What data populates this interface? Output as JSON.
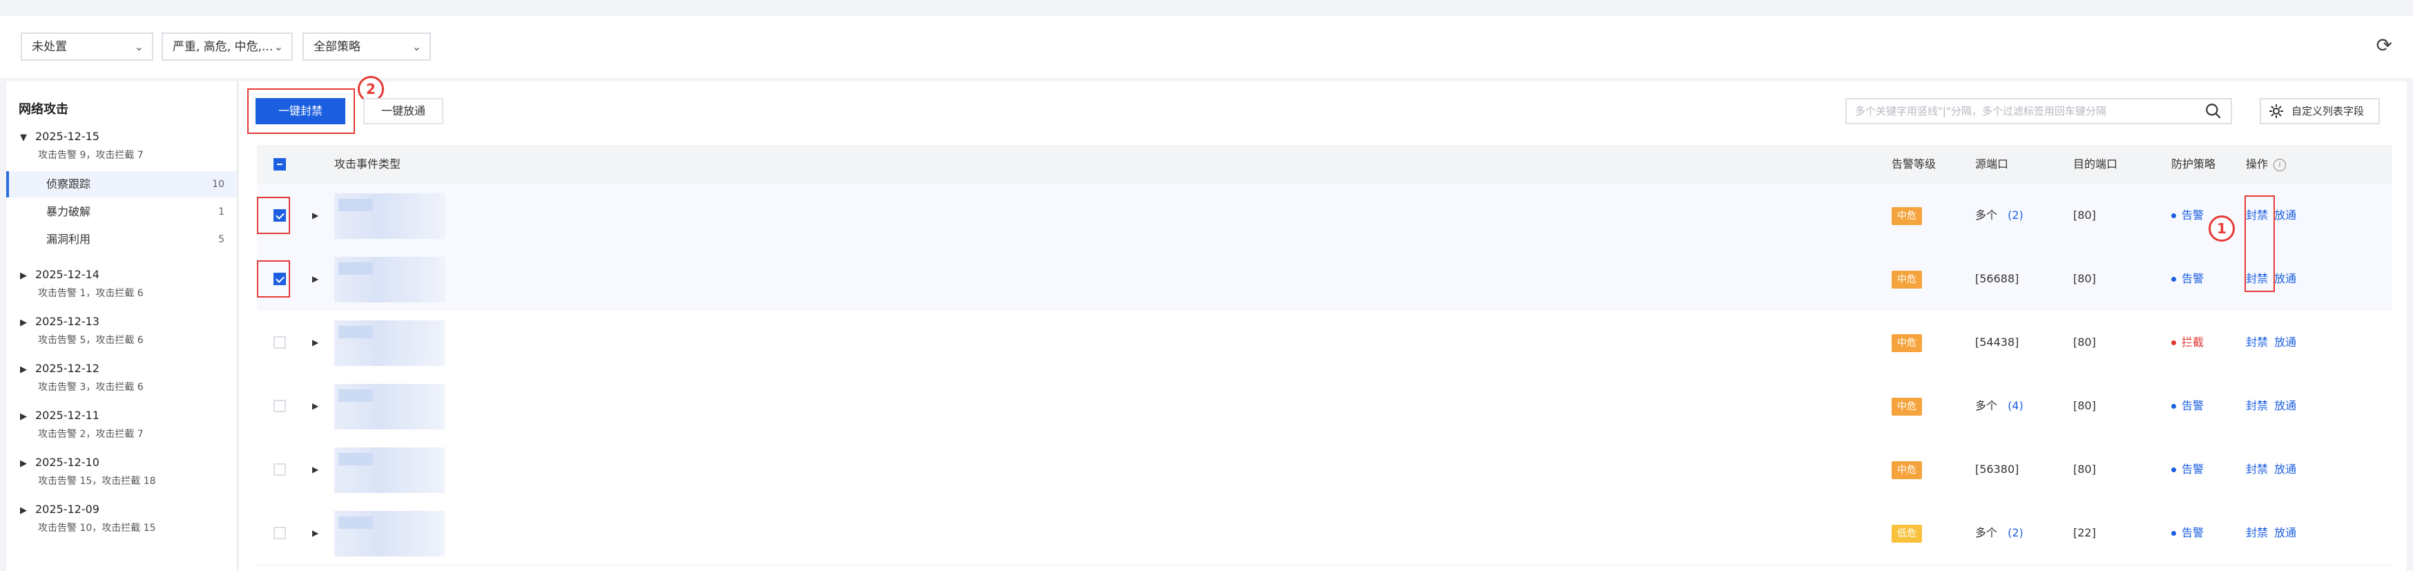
{
  "filters": [
    {
      "value": "未处置"
    },
    {
      "value": "严重, 高危, 中危,..."
    },
    {
      "value": "全部策略"
    }
  ],
  "sidebar": {
    "title": "网络攻击",
    "groups": [
      {
        "date": "2025-12-15",
        "expanded": true,
        "stats": "攻击告警 9，攻击拦截 7",
        "categories": [
          {
            "label": "侦察跟踪",
            "count": "10",
            "active": true
          },
          {
            "label": "暴力破解",
            "count": "1",
            "active": false
          },
          {
            "label": "漏洞利用",
            "count": "5",
            "active": false
          }
        ]
      },
      {
        "date": "2025-12-14",
        "expanded": false,
        "stats": "攻击告警 1，攻击拦截 6"
      },
      {
        "date": "2025-12-13",
        "expanded": false,
        "stats": "攻击告警 5，攻击拦截 6"
      },
      {
        "date": "2025-12-12",
        "expanded": false,
        "stats": "攻击告警 3，攻击拦截 6"
      },
      {
        "date": "2025-12-11",
        "expanded": false,
        "stats": "攻击告警 2，攻击拦截 7"
      },
      {
        "date": "2025-12-10",
        "expanded": false,
        "stats": "攻击告警 15，攻击拦截 18"
      },
      {
        "date": "2025-12-09",
        "expanded": false,
        "stats": "攻击告警 10，攻击拦截 15"
      }
    ]
  },
  "toolbar": {
    "block_all": "一键封禁",
    "allow_all": "一键放通",
    "search_placeholder": "多个关键字用竖线\"|\"分隔，多个过滤标签用回车键分隔",
    "custom_columns": "自定义列表字段"
  },
  "table": {
    "headers": {
      "type": "攻击事件类型",
      "level": "告警等级",
      "src_port": "源端口",
      "dst_port": "目的端口",
      "policy": "防护策略",
      "ops": "操作"
    },
    "rows": [
      {
        "checked": true,
        "level": "中危",
        "level_kind": "mid",
        "src_port": "多个",
        "src_count": "(2)",
        "dst_port": "[80]",
        "policy": "告警",
        "policy_kind": "alert",
        "op1": "封禁",
        "op2": "放通"
      },
      {
        "checked": true,
        "level": "中危",
        "level_kind": "mid",
        "src_port": "[56688]",
        "src_count": "",
        "dst_port": "[80]",
        "policy": "告警",
        "policy_kind": "alert",
        "op1": "封禁",
        "op2": "放通"
      },
      {
        "checked": false,
        "level": "中危",
        "level_kind": "mid",
        "src_port": "[54438]",
        "src_count": "",
        "dst_port": "[80]",
        "policy": "拦截",
        "policy_kind": "block",
        "op1": "封禁",
        "op2": "放通"
      },
      {
        "checked": false,
        "level": "中危",
        "level_kind": "mid",
        "src_port": "多个",
        "src_count": "(4)",
        "dst_port": "[80]",
        "policy": "告警",
        "policy_kind": "alert",
        "op1": "封禁",
        "op2": "放通"
      },
      {
        "checked": false,
        "level": "中危",
        "level_kind": "mid",
        "src_port": "[56380]",
        "src_count": "",
        "dst_port": "[80]",
        "policy": "告警",
        "policy_kind": "alert",
        "op1": "封禁",
        "op2": "放通"
      },
      {
        "checked": false,
        "level": "低危",
        "level_kind": "low",
        "src_port": "多个",
        "src_count": "(2)",
        "dst_port": "[22]",
        "policy": "告警",
        "policy_kind": "alert",
        "op1": "封禁",
        "op2": "放通"
      }
    ]
  },
  "annotations": {
    "marker1": "1",
    "marker2": "2"
  },
  "colors": {
    "primary": "#1b5fe0",
    "mid": "#f5a33c",
    "low": "#f8c23d",
    "block": "#e0352e",
    "annotation": "#e53935"
  },
  "icons": {
    "refresh": "refresh-icon",
    "search": "search-icon",
    "settings": "gear-icon",
    "info": "info-icon"
  }
}
